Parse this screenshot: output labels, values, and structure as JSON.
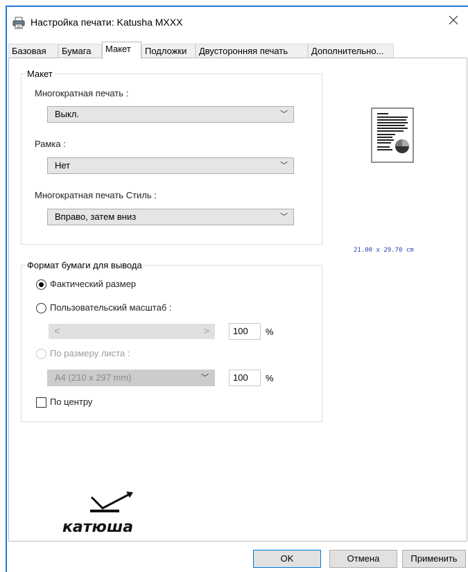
{
  "window": {
    "title": "Настройка печати: Katusha MXXX"
  },
  "tabs": [
    {
      "label": "Базовая"
    },
    {
      "label": "Бумага"
    },
    {
      "label": "Макет"
    },
    {
      "label": "Подложки"
    },
    {
      "label": "Двусторонняя печать"
    },
    {
      "label": "Дополнительно..."
    }
  ],
  "layout_group": {
    "title": "Макет",
    "multipage_label": "Многократная печать :",
    "multipage_value": "Выкл.",
    "border_label": "Рамка :",
    "border_value": "Нет",
    "order_label": "Многократная печать Стиль :",
    "order_value": "Вправо, затем вниз"
  },
  "output_group": {
    "title": "Формат бумаги для вывода",
    "actual_size_label": "Фактический размер",
    "custom_scale_label": "Пользовательский масштаб :",
    "custom_scale_value": "100",
    "fit_label": "По размеру листа :",
    "fit_paper_value": "A4 (210 x 297 mm)",
    "fit_scale_value": "100",
    "percent_symbol": "%",
    "center_label": "По центру"
  },
  "preview": {
    "paper_size_text": "21.00 x 29.70 cm"
  },
  "logo": {
    "brand": "катюша"
  },
  "buttons": {
    "ok": "OK",
    "cancel": "Отмена",
    "apply": "Применить"
  },
  "colors": {
    "accent": "#1f7ad6",
    "preview_text": "#2b3fb7"
  }
}
